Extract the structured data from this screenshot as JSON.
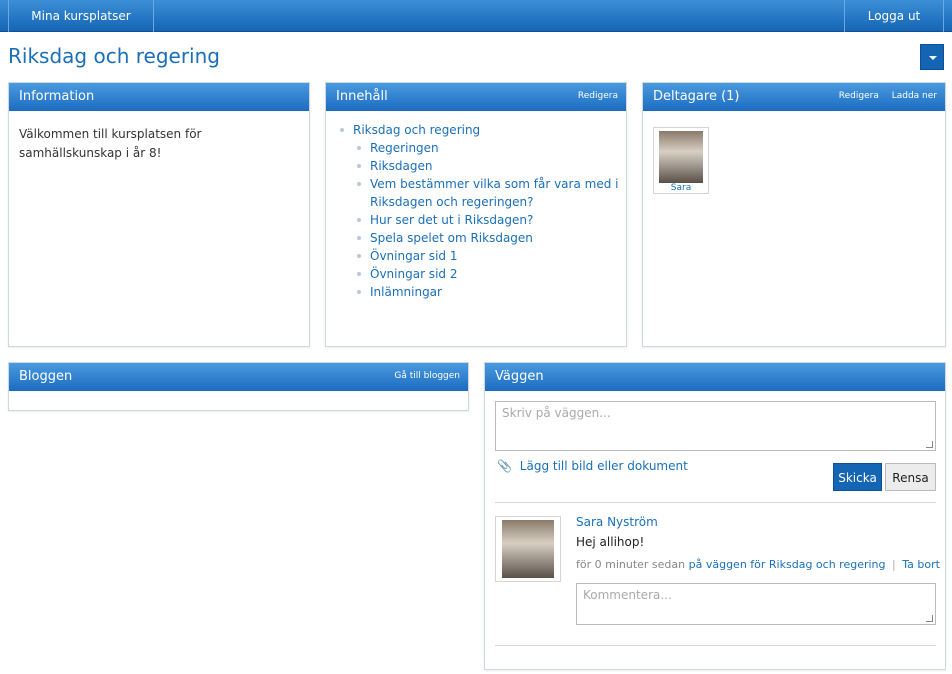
{
  "topbar": {
    "my_courses": "Mina kursplatser",
    "logout": "Logga ut"
  },
  "page": {
    "title": "Riksdag och regering"
  },
  "information": {
    "title": "Information",
    "text": "Välkommen till kursplatsen för samhällskunskap i år 8!"
  },
  "content": {
    "title": "Innehåll",
    "edit": "Redigera",
    "root": "Riksdag och regering",
    "items": [
      "Regeringen",
      "Riksdagen",
      "Vem bestämmer vilka som får vara med i Riksdagen och regeringen?",
      "Hur ser det ut i Riksdagen?",
      "Spela spelet om Riksdagen",
      "Övningar sid 1",
      "Övningar sid 2",
      "Inlämningar"
    ]
  },
  "participants": {
    "title": "Deltagare (1)",
    "edit": "Redigera",
    "invite": "Ladda ner",
    "members": [
      {
        "name": "Sara"
      }
    ]
  },
  "blog": {
    "title": "Bloggen",
    "goto": "Gå till bloggen"
  },
  "wall": {
    "title": "Väggen",
    "placeholder": "Skriv på väggen...",
    "attach": "Lägg till bild eller dokument",
    "send": "Skicka",
    "clear": "Rensa",
    "post": {
      "author": "Sara Nyström",
      "text": "Hej allihop!",
      "time": "för 0 minuter sedan",
      "context": "på väggen för Riksdag och regering",
      "separator": "|",
      "delete": "Ta bort",
      "comment_placeholder": "Kommentera..."
    }
  }
}
